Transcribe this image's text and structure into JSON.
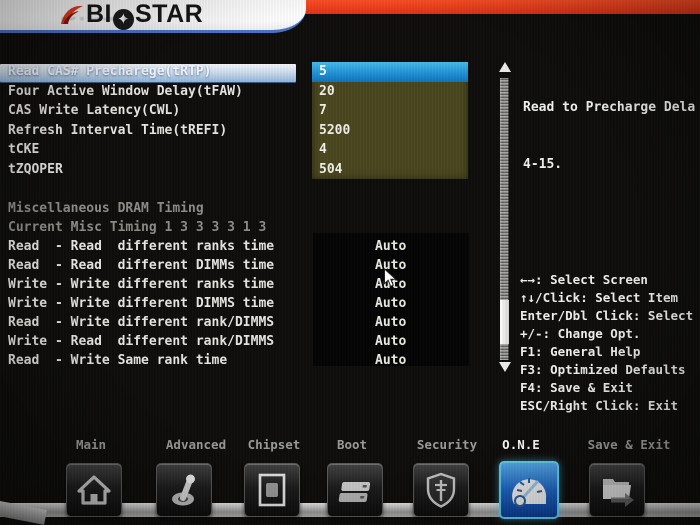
{
  "logo": {
    "pre": "BI",
    "star": "✦",
    "post": "STAR"
  },
  "main": {
    "rows": [
      {
        "label": "Read CAS# Precharege(tRTP)",
        "value": "5",
        "selected": true
      },
      {
        "label": "Four Active Window Delay(tFAW)",
        "value": "20"
      },
      {
        "label": "CAS Write Latency(CWL)",
        "value": "7"
      },
      {
        "label": "Refresh Interval Time(tREFI)",
        "value": "5200"
      },
      {
        "label": "tCKE",
        "value": "4"
      },
      {
        "label": "tZQOPER",
        "value": "504"
      }
    ],
    "section_title": "Miscellaneous DRAM Timing",
    "section_subtitle": "Current Misc Timing 1 3 3 3 3 1 3",
    "misc_rows": [
      {
        "label": "Read  - Read  different ranks time",
        "value": "Auto"
      },
      {
        "label": "Read  - Read  different DIMMs time",
        "value": "Auto"
      },
      {
        "label": "Write - Write different ranks time",
        "value": "Auto"
      },
      {
        "label": "Write - Write different DIMMS time",
        "value": "Auto"
      },
      {
        "label": "Read  - Write different rank/DIMMS",
        "value": "Auto"
      },
      {
        "label": "Write - Read  different rank/DIMMS",
        "value": "Auto"
      },
      {
        "label": "Read  - Write Same rank time",
        "value": "Auto"
      }
    ]
  },
  "help": {
    "line1": "Read to Precharge Dela",
    "line2": "4-15."
  },
  "legend": [
    "←→: Select Screen",
    "↑↓/Click: Select Item",
    "Enter/Dbl Click: Select",
    "+/-: Change Opt.",
    "F1: General Help",
    "F3: Optimized Defaults",
    "F4: Save & Exit",
    "ESC/Right Click: Exit"
  ],
  "menu": {
    "items": [
      {
        "label": "Main",
        "active": false
      },
      {
        "label": "Advanced",
        "active": false
      },
      {
        "label": "Chipset",
        "active": false
      },
      {
        "label": "Boot",
        "active": false
      },
      {
        "label": "Security",
        "active": false
      },
      {
        "label": "O.N.E",
        "active": true
      },
      {
        "label": "Save & Exit",
        "active": false
      }
    ]
  },
  "dock": {
    "icons": [
      "home",
      "switch",
      "chip",
      "drives",
      "shield",
      "gauge",
      "exit"
    ],
    "active": "gauge"
  },
  "colors": {
    "accent_red": "#ee3a1c",
    "underline_blue": "#4a74c8",
    "value_panel_olive": "#4a471f",
    "selected_value_blue": "#1073bd",
    "active_tile_border": "#5fd2f6"
  }
}
